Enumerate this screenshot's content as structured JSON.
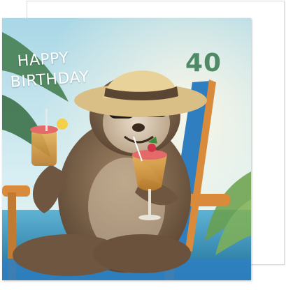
{
  "card": {
    "greeting_line1": "HAPPY",
    "greeting_line2": "BIRTHDAY",
    "age": "40"
  },
  "colors": {
    "sky": "#bfe3ec",
    "sea": "#2f8fb8",
    "chair_frame": "#d98a3a",
    "chair_fabric": "#2f7fc0",
    "age_text": "#4e8a66",
    "greeting_text": "#ffffff",
    "sloth_fur": "#7a6248",
    "hat": "#e8d29a"
  }
}
